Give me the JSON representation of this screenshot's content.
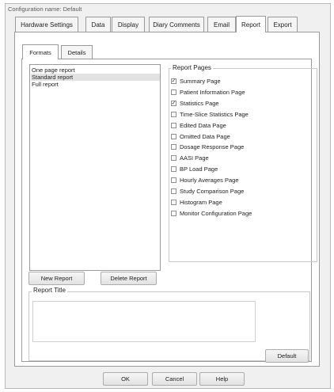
{
  "window": {
    "title": "Configuration name: Default"
  },
  "tabs": [
    {
      "label": "Hardware Settings"
    },
    {
      "label": "Data"
    },
    {
      "label": "Display"
    },
    {
      "label": "Diary Comments"
    },
    {
      "label": "Email"
    },
    {
      "label": "Report",
      "active": true
    },
    {
      "label": "Export"
    }
  ],
  "subtabs": [
    {
      "label": "Formats",
      "active": true
    },
    {
      "label": "Details"
    }
  ],
  "report_list": {
    "items": [
      "One page report",
      "Standard report",
      "Full report"
    ],
    "selected": "Standard report"
  },
  "report_pages": {
    "label": "Report Pages",
    "items": [
      {
        "label": "Summary Page",
        "checked": true
      },
      {
        "label": "Patient Information Page",
        "checked": false
      },
      {
        "label": "Statistics Page",
        "checked": true
      },
      {
        "label": "Time-Slice Statistics Page",
        "checked": false
      },
      {
        "label": "Edited Data Page",
        "checked": false
      },
      {
        "label": "Omitted Data Page",
        "checked": false
      },
      {
        "label": "Dosage Response Page",
        "checked": false
      },
      {
        "label": "AASI Page",
        "checked": false
      },
      {
        "label": "BP Load Page",
        "checked": false
      },
      {
        "label": "Hourly Averages Page",
        "checked": false
      },
      {
        "label": "Study Comparison Page",
        "checked": false
      },
      {
        "label": "Histogram Page",
        "checked": false
      },
      {
        "label": "Monitor Configuration Page",
        "checked": false
      }
    ]
  },
  "buttons": {
    "new_report": "New Report",
    "delete_report": "Delete Report",
    "default": "Default",
    "ok": "OK",
    "cancel": "Cancel",
    "help": "Help"
  },
  "report_title": {
    "label": "Report Title",
    "value": ""
  },
  "checkmark_glyph": "✓"
}
